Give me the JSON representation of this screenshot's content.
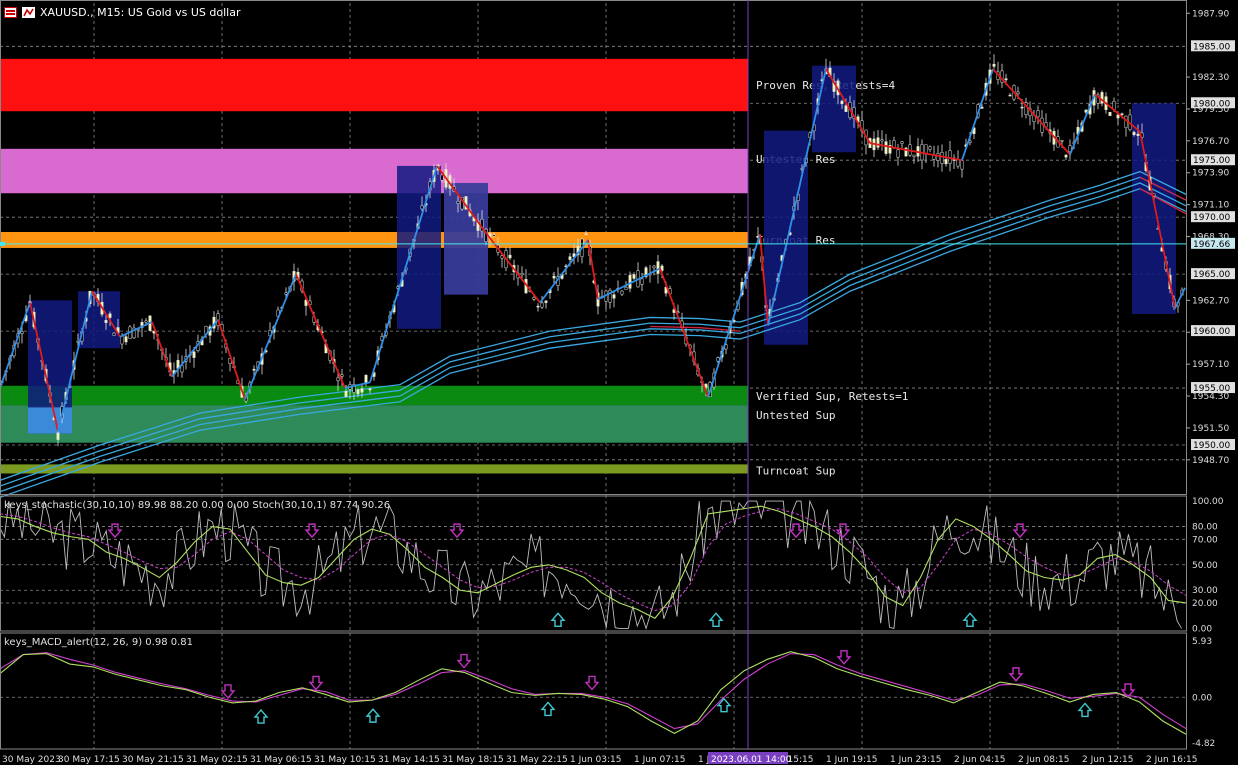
{
  "window": {
    "symbol": "XAUUSD.",
    "timeframe": "M15",
    "description": "US Gold vs US dollar",
    "title": "XAUUSD., M15:  US Gold vs US dollar",
    "icons": [
      "chart-window-icon",
      "trade-icon"
    ]
  },
  "colors": {
    "background": "#000000",
    "grid": "#8a8a8a",
    "bull_candle": "#f3f3b0",
    "bear_candle": "#e8e8e8",
    "zigzag_up": "#2f8fe8",
    "zigzag_down": "#e01a1a",
    "ma_ribbon": "#3aa8e0",
    "ma_red": "#d02040",
    "stoch_main": "#b0e060",
    "stoch_signal": "#d040d0",
    "stoch_fast": "#bdbdbd",
    "macd_main": "#b0e060",
    "macd_signal": "#d040d0",
    "arrow_down": "#c030c0",
    "arrow_up": "#40c8d0",
    "crosshair": "#40e8f0",
    "separator": "#7a3fc0"
  },
  "chart_data": [
    {
      "type": "candlestick",
      "title": "XAUUSD., M15:  US Gold vs US dollar",
      "price_ticks": [
        "1987.90",
        "1982.30",
        "1979.50",
        "1976.70",
        "1973.90",
        "1971.10",
        "1968.30",
        "1962.70",
        "1959.90",
        "1957.10",
        "1954.30",
        "1951.50",
        "1948.70"
      ],
      "ylim": [
        1945.7,
        1988.8
      ],
      "highlighted_levels": [
        "1985.00",
        "1980.00",
        "1975.00",
        "1970.00",
        "1967.66",
        "1965.00",
        "1960.00",
        "1955.00",
        "1950.00"
      ],
      "current_price": "1967.66",
      "x_ticks": [
        "30 May 2023",
        "30 May 17:15",
        "30 May 21:15",
        "31 May 02:15",
        "31 May 06:15",
        "31 May 10:15",
        "31 May 14:15",
        "31 May 18:15",
        "31 May 22:15",
        "1 Jun 03:15",
        "1 Jun 07:15",
        "1 Jun 11:15",
        "1 Jun 15:15",
        "1 Jun 19:15",
        "1 Jun 23:15",
        "2 Jun 04:15",
        "2 Jun 08:15",
        "2 Jun 12:15",
        "2 Jun 16:15"
      ],
      "cursor_time": "2023.06.01 14:00",
      "zones": [
        {
          "label": "Proven Res, Retests=4",
          "from": 1983.9,
          "to": 1979.3,
          "color": "#ff1010"
        },
        {
          "label": "Untested Res",
          "from": 1976.0,
          "to": 1972.1,
          "color": "#d86ad0"
        },
        {
          "label": "Turncoat Res",
          "from": 1968.7,
          "to": 1967.3,
          "color": "#ff9410"
        },
        {
          "label": "Verified Sup, Retests=1",
          "from": 1955.2,
          "to": 1953.5,
          "color": "#0a8a10"
        },
        {
          "label": "Untested Sup",
          "from": 1953.5,
          "to": 1950.2,
          "color": "#2e8a58"
        },
        {
          "label": "Turncoat Sup",
          "from": 1948.3,
          "to": 1947.5,
          "color": "#7a9a20"
        }
      ],
      "swing_points": [
        {
          "x": 0,
          "y": 1955.0
        },
        {
          "x": 30,
          "y": 1962.5
        },
        {
          "x": 58,
          "y": 1951.2
        },
        {
          "x": 92,
          "y": 1963.5
        },
        {
          "x": 120,
          "y": 1959.5
        },
        {
          "x": 152,
          "y": 1960.8
        },
        {
          "x": 172,
          "y": 1956.0
        },
        {
          "x": 218,
          "y": 1961.0
        },
        {
          "x": 245,
          "y": 1954.0
        },
        {
          "x": 296,
          "y": 1965.0
        },
        {
          "x": 345,
          "y": 1955.0
        },
        {
          "x": 370,
          "y": 1955.5
        },
        {
          "x": 437,
          "y": 1974.5
        },
        {
          "x": 487,
          "y": 1968.5
        },
        {
          "x": 540,
          "y": 1962.5
        },
        {
          "x": 588,
          "y": 1968.0
        },
        {
          "x": 598,
          "y": 1962.8
        },
        {
          "x": 660,
          "y": 1965.5
        },
        {
          "x": 708,
          "y": 1954.2
        },
        {
          "x": 760,
          "y": 1968.5
        },
        {
          "x": 768,
          "y": 1960.5
        },
        {
          "x": 826,
          "y": 1983.0
        },
        {
          "x": 870,
          "y": 1976.5
        },
        {
          "x": 962,
          "y": 1975.0
        },
        {
          "x": 993,
          "y": 1983.0
        },
        {
          "x": 1070,
          "y": 1975.5
        },
        {
          "x": 1095,
          "y": 1980.8
        },
        {
          "x": 1140,
          "y": 1977.5
        },
        {
          "x": 1175,
          "y": 1962.0
        },
        {
          "x": 1185,
          "y": 1963.8
        }
      ],
      "boxes": [
        {
          "x0": 28,
          "x1": 72,
          "hi": 1962.7,
          "lo": 1951.0
        },
        {
          "x0": 78,
          "x1": 120,
          "hi": 1963.5,
          "lo": 1958.5
        },
        {
          "x0": 397,
          "x1": 441,
          "hi": 1974.5,
          "lo": 1960.2
        },
        {
          "x0": 444,
          "x1": 488,
          "hi": 1973.0,
          "lo": 1963.2
        },
        {
          "x0": 764,
          "x1": 808,
          "hi": 1977.6,
          "lo": 1958.8
        },
        {
          "x0": 812,
          "x1": 856,
          "hi": 1983.3,
          "lo": 1975.7
        },
        {
          "x0": 1132,
          "x1": 1176,
          "hi": 1980.0,
          "lo": 1961.5
        }
      ],
      "ma_ribbon": [
        {
          "x": 0,
          "y": 1945.9
        },
        {
          "x": 100,
          "y": 1949.0
        },
        {
          "x": 200,
          "y": 1951.8
        },
        {
          "x": 300,
          "y": 1953.2
        },
        {
          "x": 400,
          "y": 1954.3
        },
        {
          "x": 450,
          "y": 1956.8
        },
        {
          "x": 550,
          "y": 1959.0
        },
        {
          "x": 650,
          "y": 1960.2
        },
        {
          "x": 700,
          "y": 1960.1
        },
        {
          "x": 740,
          "y": 1959.8
        },
        {
          "x": 800,
          "y": 1961.5
        },
        {
          "x": 850,
          "y": 1964.0
        },
        {
          "x": 950,
          "y": 1967.5
        },
        {
          "x": 1050,
          "y": 1970.5
        },
        {
          "x": 1100,
          "y": 1971.8
        },
        {
          "x": 1140,
          "y": 1973.0
        },
        {
          "x": 1186,
          "y": 1971.0
        }
      ]
    },
    {
      "type": "line",
      "title": "keys_stochastic(30,10,10) 89.98 88.20 0.00 0.00 Stoch(30,10,1) 87.74 90.26",
      "y_ticks": [
        "100.00",
        "80.00",
        "70.00",
        "50.00",
        "30.00",
        "20.00",
        "0.00"
      ],
      "ylim": [
        -2,
        104
      ],
      "levels": [
        80,
        70,
        50,
        30,
        20
      ],
      "series": [
        {
          "values_main": [
            88,
            86,
            80,
            75,
            72,
            70,
            60,
            55,
            48,
            40,
            52,
            68,
            80,
            78,
            60,
            42,
            36,
            34,
            40,
            55,
            70,
            78,
            74,
            62,
            48,
            40,
            30,
            28,
            35,
            42,
            48,
            50,
            46,
            40,
            28,
            20,
            15,
            8,
            25,
            55,
            90,
            92,
            94,
            96,
            92,
            86,
            80,
            72,
            60,
            45,
            25,
            18,
            40,
            70,
            86,
            80,
            70,
            58,
            45,
            40,
            38,
            42,
            55,
            58,
            50,
            40,
            22,
            20
          ]
        },
        {
          "values_signal": [
            90,
            88,
            84,
            79,
            75,
            72,
            66,
            60,
            53,
            47,
            48,
            58,
            70,
            76,
            70,
            58,
            46,
            40,
            38,
            46,
            58,
            70,
            74,
            68,
            58,
            48,
            38,
            32,
            33,
            38,
            44,
            48,
            48,
            44,
            36,
            27,
            20,
            14,
            18,
            35,
            64,
            82,
            88,
            92,
            94,
            90,
            84,
            78,
            68,
            56,
            40,
            28,
            32,
            50,
            70,
            78,
            74,
            66,
            56,
            48,
            42,
            42,
            48,
            55,
            52,
            45,
            34,
            26
          ]
        }
      ],
      "arrows_down": [
        115,
        312,
        457,
        796,
        843,
        1020
      ],
      "arrows_up": [
        558,
        716,
        970
      ]
    },
    {
      "type": "line",
      "title": "keys_MACD_alert(12, 26, 9) 0.98 0.81",
      "y_ticks": [
        "5.93",
        "0.00",
        "-4.82"
      ],
      "ylim": [
        -4.82,
        5.93
      ],
      "series": [
        {
          "values_main": [
            2.5,
            4.5,
            4.6,
            3.5,
            3.2,
            2.4,
            1.8,
            1.2,
            0.8,
            0.0,
            -0.6,
            -0.4,
            0.5,
            1.0,
            0.3,
            -0.5,
            -0.3,
            0.5,
            1.8,
            3.0,
            2.6,
            1.5,
            0.5,
            0.2,
            0.4,
            0.3,
            -0.2,
            -1.0,
            -2.5,
            -3.8,
            -2.5,
            0.8,
            2.8,
            4.0,
            4.8,
            4.2,
            3.0,
            2.2,
            1.5,
            0.8,
            0.2,
            -0.6,
            0.5,
            1.6,
            1.2,
            0.4,
            -0.5,
            0.3,
            0.5,
            -0.5,
            -2.5,
            -3.9
          ]
        },
        {
          "values_signal": [
            3.0,
            4.5,
            4.7,
            4.0,
            3.4,
            2.6,
            2.0,
            1.4,
            0.9,
            0.2,
            -0.4,
            -0.5,
            0.2,
            0.9,
            0.6,
            -0.3,
            -0.3,
            0.3,
            1.4,
            2.6,
            2.8,
            1.9,
            0.9,
            0.3,
            0.4,
            0.4,
            0.0,
            -0.7,
            -2.0,
            -3.3,
            -2.8,
            -0.3,
            1.9,
            3.5,
            4.6,
            4.5,
            3.4,
            2.5,
            1.8,
            1.1,
            0.4,
            -0.3,
            0.2,
            1.3,
            1.4,
            0.7,
            -0.1,
            0.1,
            0.4,
            0.0,
            -1.8,
            -3.3
          ]
        }
      ],
      "arrows_down": [
        228,
        316,
        464,
        592,
        844,
        1016,
        1128
      ],
      "arrows_up": [
        261,
        373,
        548,
        724,
        1085
      ]
    }
  ],
  "panels": {
    "stoch_title": "keys_stochastic(30,10,10) 89.98 88.20 0.00 0.00 Stoch(30,10,1) 87.74 90.26",
    "macd_title": "keys_MACD_alert(12, 26, 9) 0.98 0.81"
  }
}
